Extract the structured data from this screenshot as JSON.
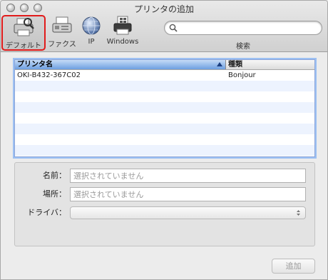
{
  "window": {
    "title": "プリンタの追加"
  },
  "toolbar": {
    "items": [
      {
        "label": "デフォルト",
        "icon": "default-printer-icon"
      },
      {
        "label": "ファクス",
        "icon": "fax-icon"
      },
      {
        "label": "IP",
        "icon": "ip-globe-icon"
      },
      {
        "label": "Windows",
        "icon": "windows-printer-icon"
      }
    ],
    "search": {
      "value": "",
      "placeholder": "",
      "label": "検索"
    }
  },
  "printer_table": {
    "columns": [
      "プリンタ名",
      "種類"
    ],
    "rows": [
      {
        "name": "OKI-B432-367C02",
        "kind": "Bonjour"
      }
    ]
  },
  "details": {
    "name": {
      "label": "名前：",
      "placeholder": "選択されていません"
    },
    "location": {
      "label": "場所：",
      "placeholder": "選択されていません"
    },
    "driver": {
      "label": "ドライバ：",
      "value": ""
    }
  },
  "actions": {
    "add_label": "追加"
  },
  "colors": {
    "accent": "#6d9fe0",
    "selected_outline": "#e11b1b"
  }
}
